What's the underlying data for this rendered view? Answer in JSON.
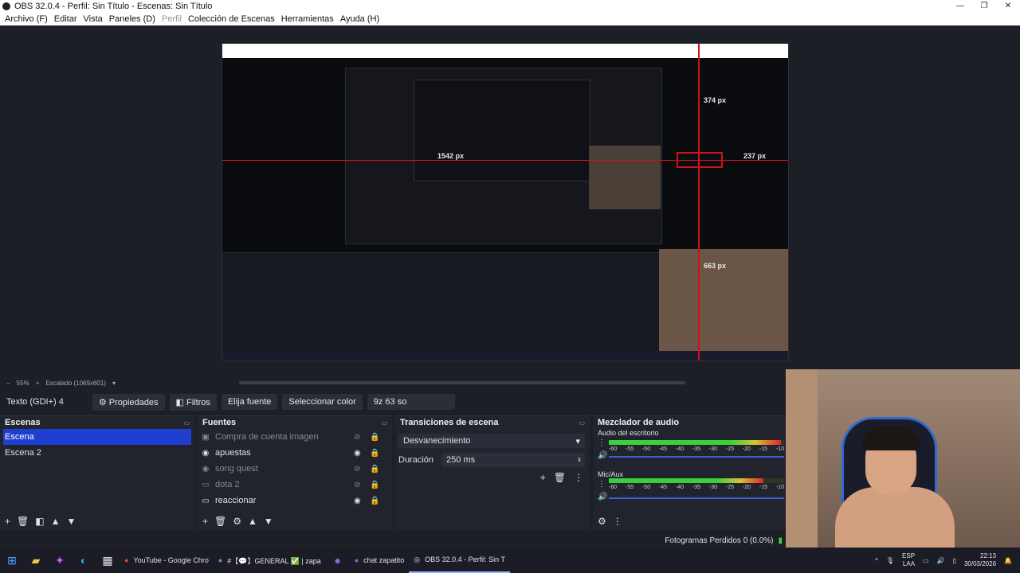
{
  "window": {
    "title": "OBS 32.0.4 - Perfil: Sin Título - Escenas: Sin Título",
    "minimize": "—",
    "maximize": "❐",
    "close": "✕"
  },
  "menu": {
    "items": [
      "Archivo (F)",
      "Editar",
      "Vista",
      "Paneles (D)",
      "Perfil",
      "Colección de Escenas",
      "Herramientas",
      "Ayuda (H)"
    ]
  },
  "preview": {
    "labels": {
      "w374": "374 px",
      "w237": "237 px",
      "w1542": "1542 px",
      "w663": "663 px"
    }
  },
  "zoom": {
    "minus": "−",
    "level": "55%",
    "plus": "+",
    "scale_label": "Escalado (1069x601)",
    "dropdown": "▾"
  },
  "source_toolbar": {
    "source_name": "Texto (GDI+) 4",
    "properties": "Propiedades",
    "filters": "Filtros",
    "choose_font": "Elija fuente",
    "select_color": "Seleccionar color",
    "text_value": "9z 63 so"
  },
  "scenes": {
    "title": "Escenas",
    "items": [
      "Escena",
      "Escena 2"
    ]
  },
  "sources": {
    "title": "Fuentes",
    "items": [
      {
        "name": "Compra de cuenta imagen",
        "icon": "▣"
      },
      {
        "name": "apuestas",
        "icon": "◉"
      },
      {
        "name": "song quest",
        "icon": "◉"
      },
      {
        "name": "dota 2",
        "icon": "▭"
      },
      {
        "name": "reaccionar",
        "icon": "▭"
      }
    ]
  },
  "transitions": {
    "title": "Transiciones de escena",
    "selected": "Desvanecimiento",
    "duration_label": "Duración",
    "duration_value": "250 ms"
  },
  "mixer": {
    "title": "Mezclador de audio",
    "channels": [
      {
        "name": "Audio del escritorio",
        "level": 0.98
      },
      {
        "name": "Mic/Aux",
        "level": 0.88
      }
    ],
    "scale": [
      "-60",
      "-55",
      "-50",
      "-45",
      "-40",
      "-35",
      "-30",
      "-25",
      "-20",
      "-15",
      "-10"
    ],
    "colors": {
      "green": "#3ad03a",
      "yellow": "#d4c431",
      "red": "#e0242a"
    }
  },
  "status": {
    "dropped_frames": "Fotogramas Perdidos 0 (0.0%)"
  },
  "taskbar": {
    "apps": [
      {
        "label": "YouTube - Google Chro"
      },
      {
        "label": "#【💬】GENERAL ✅ | zapa"
      },
      {
        "label": "chat zapatito"
      },
      {
        "label": "OBS 32.0.4 - Perfil: Sin T"
      }
    ],
    "lang": "ESP",
    "lang2": "LAA",
    "time": "22:13",
    "date": "30/03/2026"
  }
}
